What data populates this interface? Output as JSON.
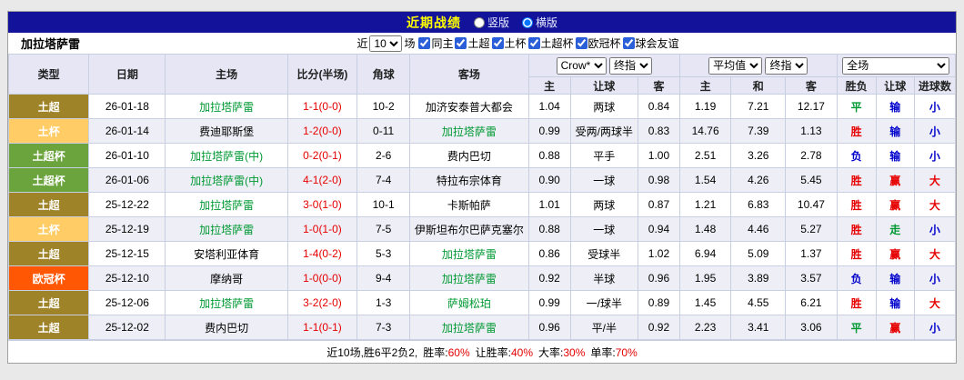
{
  "titlebar": {
    "title": "近期战绩",
    "vertical_label": "竖版",
    "horizontal_label": "横版",
    "selected": "横版"
  },
  "filter": {
    "team": "加拉塔萨雷",
    "near_label": "近",
    "count_value": "10",
    "games_label": "场",
    "checkboxes": [
      {
        "label": "同主",
        "checked": true
      },
      {
        "label": "土超",
        "checked": true
      },
      {
        "label": "土杯",
        "checked": true
      },
      {
        "label": "土超杯",
        "checked": true
      },
      {
        "label": "欧冠杯",
        "checked": true
      },
      {
        "label": "球会友谊",
        "checked": true
      }
    ]
  },
  "table": {
    "headers": {
      "type": "类型",
      "date": "日期",
      "home": "主场",
      "score": "比分(半场)",
      "corner": "角球",
      "away": "客场",
      "selects": {
        "odds_source": "Crow*",
        "odds_final": "终指",
        "avg": "平均值",
        "avg_final": "终指",
        "scope": "全场"
      },
      "sub": [
        "主",
        "让球",
        "客",
        "主",
        "和",
        "客",
        "胜负",
        "让球",
        "进球数"
      ]
    },
    "type_colors": {
      "土超": "#9f8329",
      "土杯": "#ffcc66",
      "土超杯": "#6ba43c",
      "欧冠杯": "#ff5703"
    },
    "result_colors": {
      "胜": "#e60000",
      "平": "#009933",
      "负": "#0000cc",
      "赢": "#e60000",
      "走": "#009933",
      "输": "#0000cc",
      "大": "#e60000",
      "小": "#0000cc"
    },
    "rows": [
      {
        "type": "土超",
        "date": "26-01-18",
        "home": "加拉塔萨雷",
        "home_green": true,
        "score": "1-1(0-0)",
        "corner": "10-2",
        "away": "加济安泰普大都会",
        "away_green": false,
        "odds": {
          "home": "1.04",
          "line": "两球",
          "away": "0.84"
        },
        "avg": {
          "home": "1.19",
          "draw": "7.21",
          "away": "12.17"
        },
        "result": "平",
        "handicap_result": "输",
        "goals": "小"
      },
      {
        "type": "土杯",
        "date": "26-01-14",
        "home": "费迪耶斯堡",
        "home_green": false,
        "score": "1-2(0-0)",
        "corner": "0-11",
        "away": "加拉塔萨雷",
        "away_green": true,
        "odds": {
          "home": "0.99",
          "line": "受两/两球半",
          "away": "0.83"
        },
        "avg": {
          "home": "14.76",
          "draw": "7.39",
          "away": "1.13"
        },
        "result": "胜",
        "handicap_result": "输",
        "goals": "小"
      },
      {
        "type": "土超杯",
        "date": "26-01-10",
        "home": "加拉塔萨雷(中)",
        "home_green": true,
        "score": "0-2(0-1)",
        "corner": "2-6",
        "away": "费内巴切",
        "away_green": false,
        "odds": {
          "home": "0.88",
          "line": "平手",
          "away": "1.00"
        },
        "avg": {
          "home": "2.51",
          "draw": "3.26",
          "away": "2.78"
        },
        "result": "负",
        "handicap_result": "输",
        "goals": "小"
      },
      {
        "type": "土超杯",
        "date": "26-01-06",
        "home": "加拉塔萨雷(中)",
        "home_green": true,
        "score": "4-1(2-0)",
        "corner": "7-4",
        "away": "特拉布宗体育",
        "away_green": false,
        "odds": {
          "home": "0.90",
          "line": "一球",
          "away": "0.98"
        },
        "avg": {
          "home": "1.54",
          "draw": "4.26",
          "away": "5.45"
        },
        "result": "胜",
        "handicap_result": "赢",
        "goals": "大"
      },
      {
        "type": "土超",
        "date": "25-12-22",
        "home": "加拉塔萨雷",
        "home_green": true,
        "score": "3-0(1-0)",
        "corner": "10-1",
        "away": "卡斯帕萨",
        "away_green": false,
        "odds": {
          "home": "1.01",
          "line": "两球",
          "away": "0.87"
        },
        "avg": {
          "home": "1.21",
          "draw": "6.83",
          "away": "10.47"
        },
        "result": "胜",
        "handicap_result": "赢",
        "goals": "大"
      },
      {
        "type": "土杯",
        "date": "25-12-19",
        "home": "加拉塔萨雷",
        "home_green": true,
        "score": "1-0(1-0)",
        "corner": "7-5",
        "away": "伊斯坦布尔巴萨克塞尔",
        "away_green": false,
        "odds": {
          "home": "0.88",
          "line": "一球",
          "away": "0.94"
        },
        "avg": {
          "home": "1.48",
          "draw": "4.46",
          "away": "5.27"
        },
        "result": "胜",
        "handicap_result": "走",
        "goals": "小"
      },
      {
        "type": "土超",
        "date": "25-12-15",
        "home": "安塔利亚体育",
        "home_green": false,
        "score": "1-4(0-2)",
        "corner": "5-3",
        "away": "加拉塔萨雷",
        "away_green": true,
        "odds": {
          "home": "0.86",
          "line": "受球半",
          "away": "1.02"
        },
        "avg": {
          "home": "6.94",
          "draw": "5.09",
          "away": "1.37"
        },
        "result": "胜",
        "handicap_result": "赢",
        "goals": "大"
      },
      {
        "type": "欧冠杯",
        "date": "25-12-10",
        "home": "摩纳哥",
        "home_green": false,
        "score": "1-0(0-0)",
        "corner": "9-4",
        "away": "加拉塔萨雷",
        "away_green": true,
        "odds": {
          "home": "0.92",
          "line": "半球",
          "away": "0.96"
        },
        "avg": {
          "home": "1.95",
          "draw": "3.89",
          "away": "3.57"
        },
        "result": "负",
        "handicap_result": "输",
        "goals": "小"
      },
      {
        "type": "土超",
        "date": "25-12-06",
        "home": "加拉塔萨雷",
        "home_green": true,
        "score": "3-2(2-0)",
        "corner": "1-3",
        "away": "萨姆松珀",
        "away_green": true,
        "odds": {
          "home": "0.99",
          "line": "一/球半",
          "away": "0.89"
        },
        "avg": {
          "home": "1.45",
          "draw": "4.55",
          "away": "6.21"
        },
        "result": "胜",
        "handicap_result": "输",
        "goals": "大"
      },
      {
        "type": "土超",
        "date": "25-12-02",
        "home": "费内巴切",
        "home_green": false,
        "score": "1-1(0-1)",
        "corner": "7-3",
        "away": "加拉塔萨雷",
        "away_green": true,
        "odds": {
          "home": "0.96",
          "line": "平/半",
          "away": "0.92"
        },
        "avg": {
          "home": "2.23",
          "draw": "3.41",
          "away": "3.06"
        },
        "result": "平",
        "handicap_result": "赢",
        "goals": "小"
      }
    ]
  },
  "footer": {
    "prefix": "近10场,胜6平2负2,",
    "stats": [
      {
        "label": "胜率:",
        "value": "60%"
      },
      {
        "label": "让胜率:",
        "value": "40%"
      },
      {
        "label": "大率:",
        "value": "30%"
      },
      {
        "label": "单率:",
        "value": "70%"
      }
    ]
  }
}
